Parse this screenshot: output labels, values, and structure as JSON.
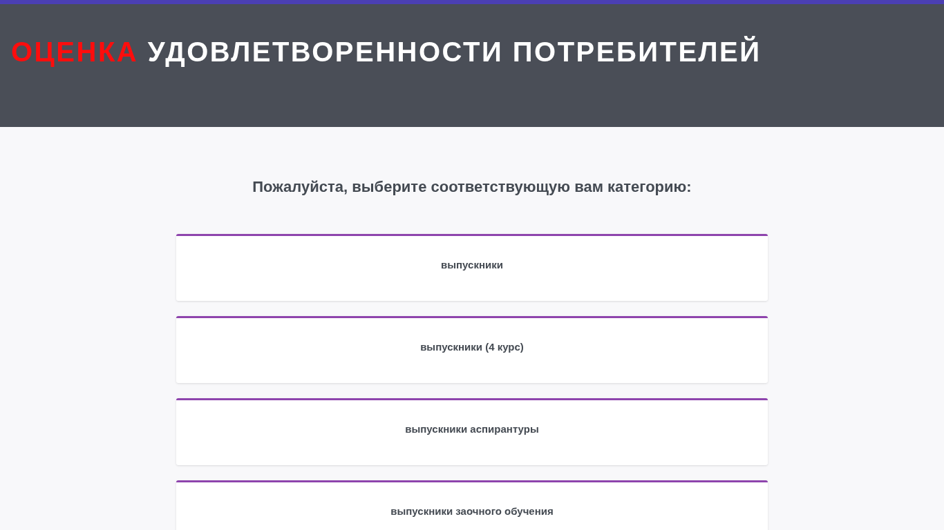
{
  "header": {
    "title": [
      {
        "text": "ОЦЕНКА",
        "highlight": true
      },
      {
        "text": "УДОВЛЕТВОРЕННОСТИ ПОТРЕБИТЕЛЕЙ",
        "highlight": false
      }
    ]
  },
  "prompt": "Пожалуйста, выберите соответствующую вам категорию:",
  "categories": [
    {
      "label": "выпускники"
    },
    {
      "label": "выпускники (4 курс)"
    },
    {
      "label": "выпускники аспирантуры"
    },
    {
      "label": "выпускники заочного обучения"
    }
  ]
}
